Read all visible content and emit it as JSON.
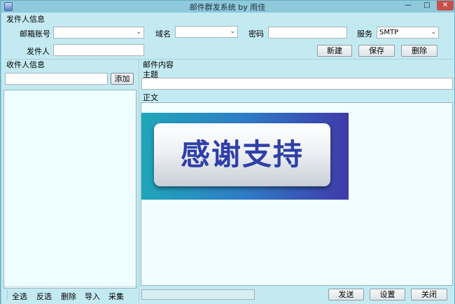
{
  "window": {
    "title": "邮件群发系统 by 雨佳"
  },
  "controls": {
    "minimize": "—",
    "maximize": "□",
    "close": "✕"
  },
  "sender": {
    "group_label": "发件人信息",
    "account_label": "邮箱账号",
    "account_value": "",
    "domain_label": "域名",
    "domain_value": "",
    "password_label": "密码",
    "service_label": "服务",
    "service_value": "SMTP",
    "sender_label": "发件人",
    "buttons": {
      "new": "新建",
      "save": "保存",
      "delete": "删除"
    }
  },
  "recipients": {
    "group_label": "收件人信息",
    "add_button": "添加",
    "actions": [
      "全选",
      "反选",
      "删除",
      "导入",
      "采集"
    ]
  },
  "content": {
    "group_label": "邮件内容",
    "subject_label": "主题",
    "body_label": "正文",
    "banner_text": "感谢支持"
  },
  "footer": {
    "send": "发送",
    "settings": "设置",
    "close": "关闭"
  }
}
